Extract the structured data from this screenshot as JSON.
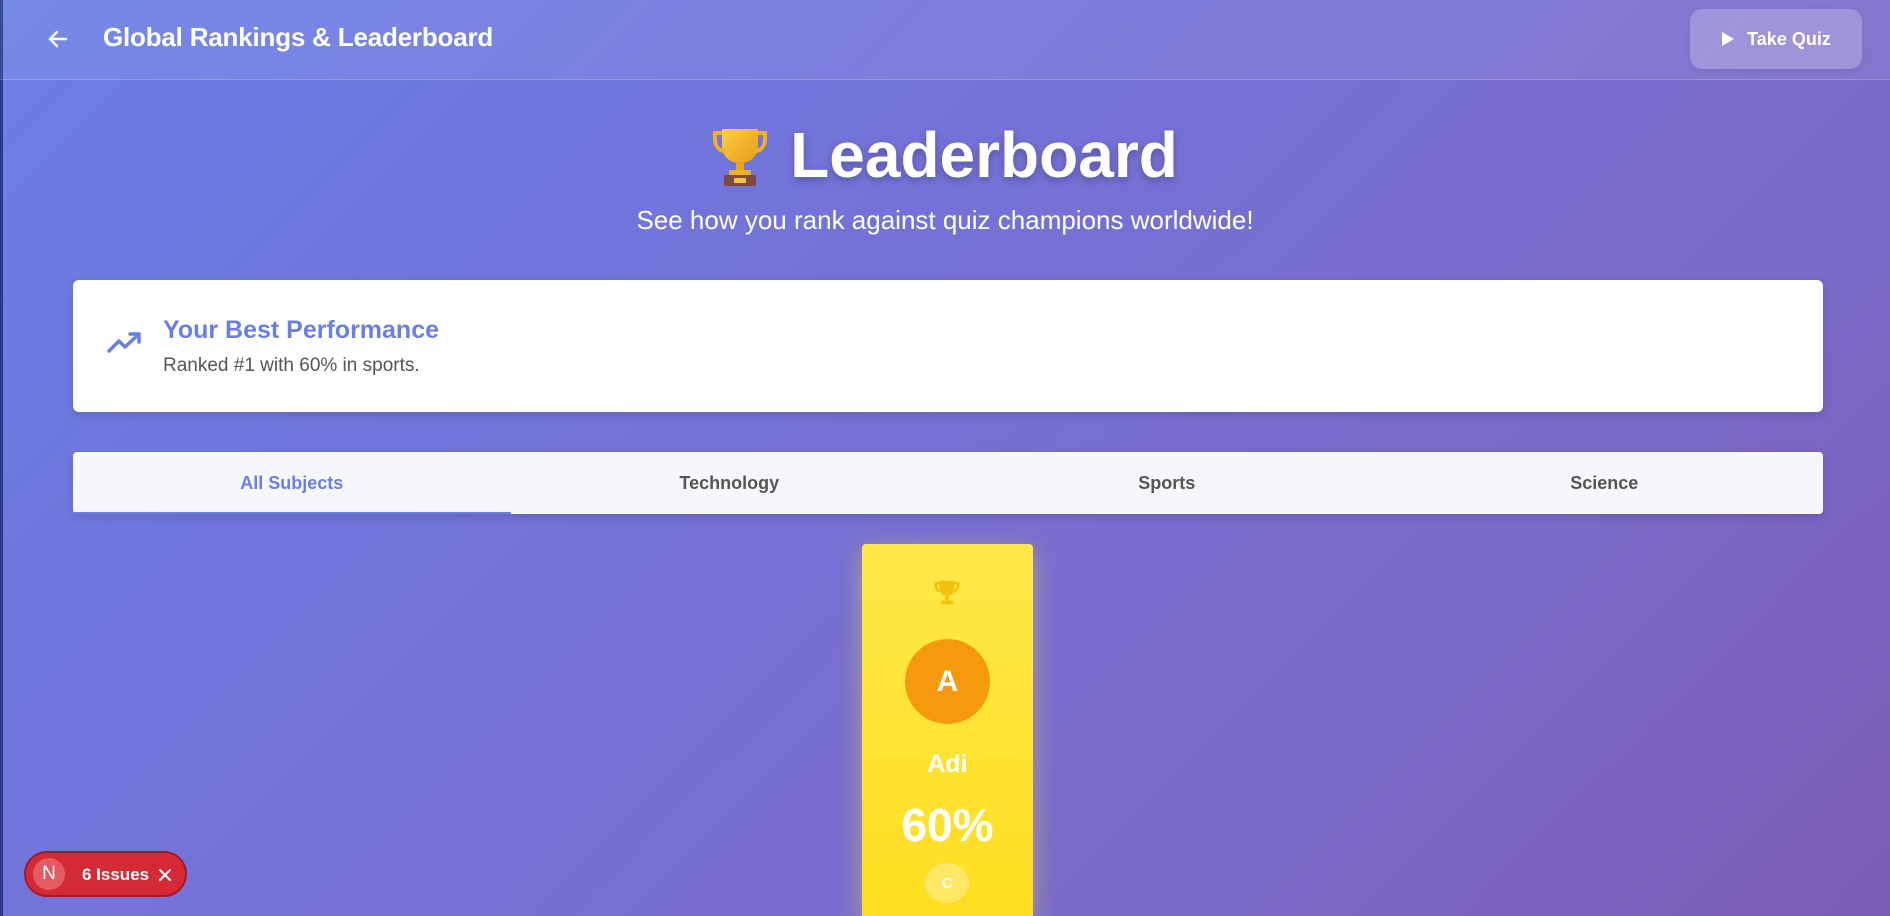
{
  "header": {
    "title": "Global Rankings & Leaderboard",
    "back_icon": "arrow-left-icon",
    "take_quiz_label": "Take Quiz",
    "take_quiz_icon": "play-icon"
  },
  "hero": {
    "emoji": "🏆",
    "title": "Leaderboard",
    "subtitle": "See how you rank against quiz champions worldwide!"
  },
  "best_performance": {
    "icon": "trending-up-icon",
    "title": "Your Best Performance",
    "description": "Ranked #1 with 60% in sports."
  },
  "tabs": [
    {
      "label": "All Subjects",
      "active": true
    },
    {
      "label": "Technology",
      "active": false
    },
    {
      "label": "Sports",
      "active": false
    },
    {
      "label": "Science",
      "active": false
    }
  ],
  "podium": {
    "first": {
      "icon": "trophy-icon",
      "initial": "A",
      "name": "Adi",
      "score": "60%",
      "badge": "C"
    }
  },
  "issues_badge": {
    "initial": "N",
    "label": "6 Issues",
    "close_icon": "close-icon"
  },
  "colors": {
    "accent": "#6a7fe6",
    "podium_gold": "#ffe13a",
    "avatar_orange": "#f59a0c",
    "issues_red": "#d42a35"
  }
}
